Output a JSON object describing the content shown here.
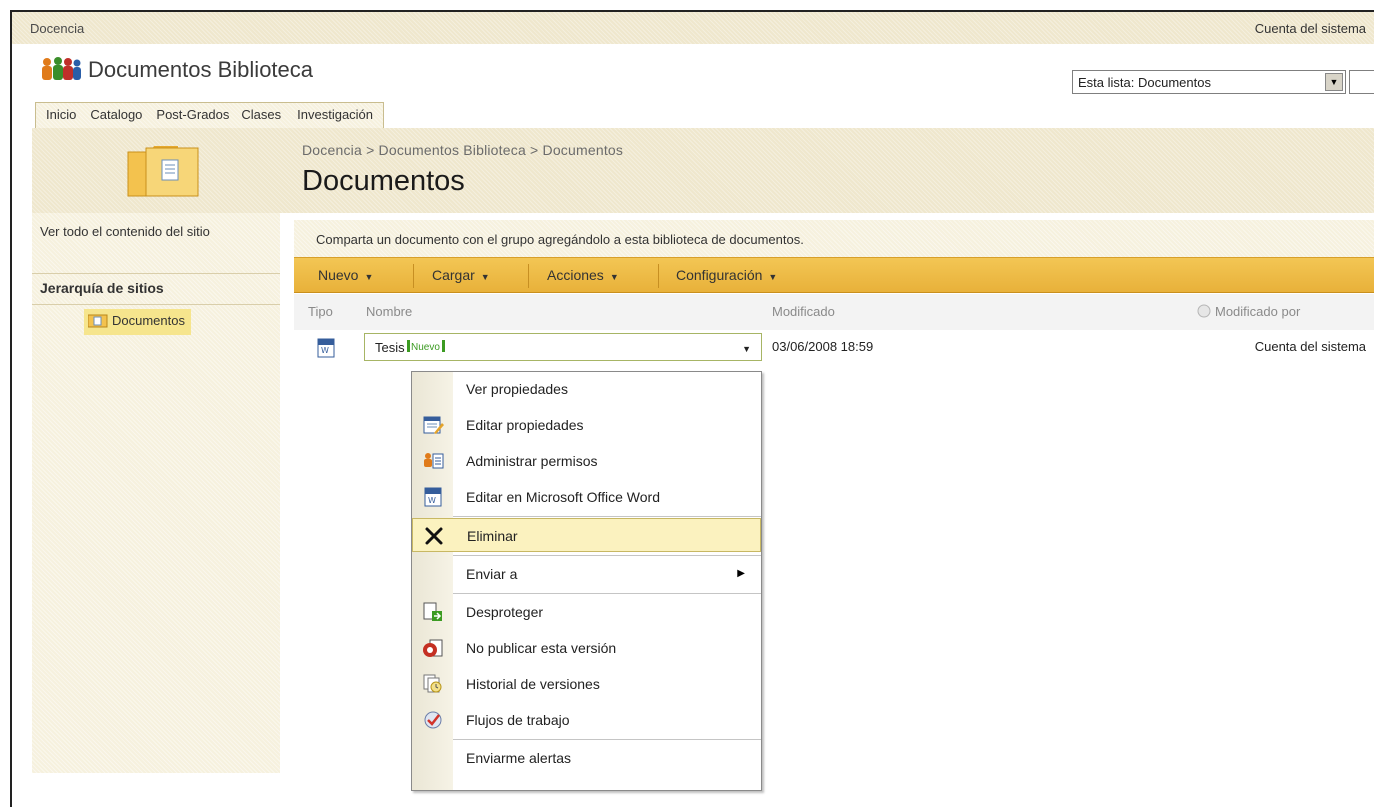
{
  "topbar": {
    "site": "Docencia",
    "user": "Cuenta del sistema"
  },
  "header": {
    "site_title": "Documentos Biblioteca",
    "scope_selected": "Esta lista: Documentos"
  },
  "tabs": [
    "Inicio",
    "Catalogo",
    "Post-Grados",
    "Clases",
    "Investigación"
  ],
  "breadcrumb": [
    "Docencia",
    "Documentos Biblioteca",
    "Documentos"
  ],
  "breadcrumb_sep": ">",
  "page_title": "Documentos",
  "leftnav": {
    "view_all": "Ver todo el contenido del sitio",
    "hierarchy": "Jerarquía de sitios",
    "item": "Documentos"
  },
  "description": "Comparta un documento con el grupo agregándolo a esta biblioteca de documentos.",
  "toolbar": [
    "Nuevo",
    "Cargar",
    "Acciones",
    "Configuración"
  ],
  "columns": {
    "type": "Tipo",
    "name": "Nombre",
    "modified": "Modificado",
    "modified_by": "Modificado por"
  },
  "row": {
    "name": "Tesis",
    "new_tag": "Nuevo",
    "modified": "03/06/2008 18:59",
    "modified_by": "Cuenta del sistema"
  },
  "menu": [
    {
      "label": "Ver propiedades",
      "icon": "none"
    },
    {
      "label": "Editar propiedades",
      "icon": "edit-properties-icon"
    },
    {
      "label": "Administrar permisos",
      "icon": "permissions-icon"
    },
    {
      "label": "Editar en Microsoft Office Word",
      "icon": "word-document-icon"
    },
    {
      "label": "Eliminar",
      "icon": "delete-x-icon",
      "highlighted": true
    },
    {
      "label": "Enviar a",
      "icon": "none",
      "submenu": true
    },
    {
      "label": "Desproteger",
      "icon": "checkout-icon"
    },
    {
      "label": "No publicar esta versión",
      "icon": "unpublish-icon"
    },
    {
      "label": "Historial de versiones",
      "icon": "version-history-icon"
    },
    {
      "label": "Flujos de trabajo",
      "icon": "workflow-icon"
    },
    {
      "label": "Enviarme alertas",
      "icon": "none"
    }
  ],
  "colors": {
    "toolbar": "#f3c654",
    "band": "#efe7cd",
    "highlight": "#fbf2bf",
    "nav_selected": "#f6e58d"
  }
}
